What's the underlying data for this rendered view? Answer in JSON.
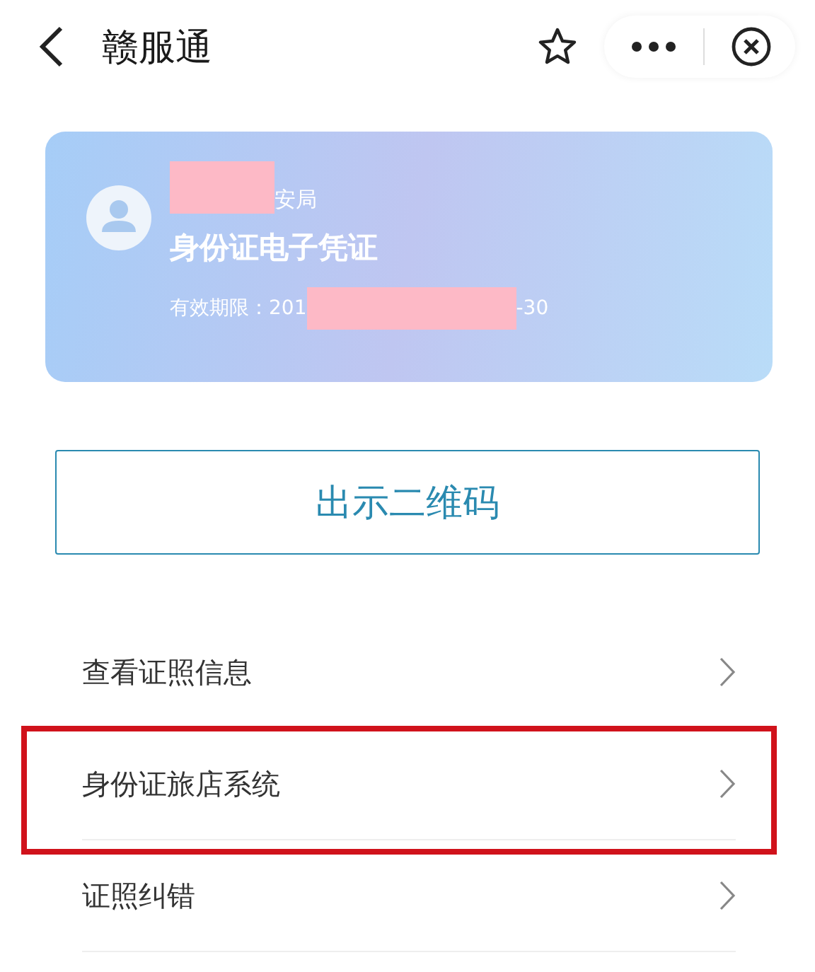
{
  "header": {
    "title": "赣服通"
  },
  "card": {
    "issuer_parts": [
      {
        "kind": "redaction"
      },
      {
        "kind": "text",
        "text": "安局"
      }
    ],
    "title": "身份证电子凭证",
    "validity_parts": [
      {
        "kind": "text",
        "text": "有效期限：201"
      },
      {
        "kind": "redaction"
      },
      {
        "kind": "text",
        "text": "-30"
      }
    ]
  },
  "qr_button": {
    "label": "出示二维码"
  },
  "menu": [
    {
      "label": "查看证照信息",
      "highlighted": false
    },
    {
      "label": "身份证旅店系统",
      "highlighted": true
    },
    {
      "label": "证照纠错",
      "highlighted": false
    }
  ]
}
